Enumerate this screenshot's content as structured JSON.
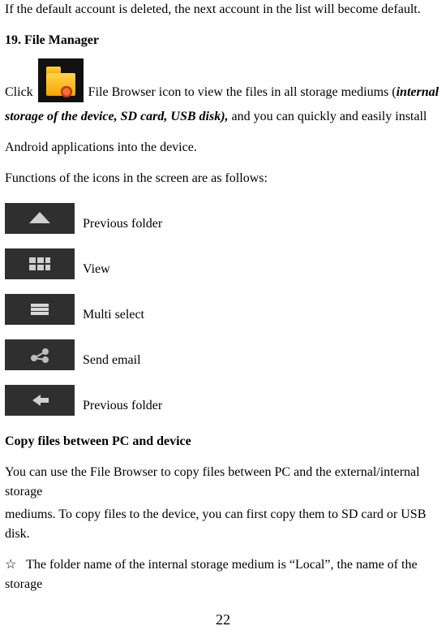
{
  "intro_line": "If the default account is deleted, the next account in the list will become default.",
  "section_heading": "19. File Manager",
  "click_label": "Click",
  "after_icon_text_1": " File Browser icon to view the files in all storage mediums (",
  "bold_italic_1": "internal storage of the device, SD card, USB disk),",
  "after_bold_1": " and you can quickly and easily install",
  "cont_line_2": "Android applications into the device.",
  "functions_line": "Functions of the icons in the screen are as follows:",
  "icons": [
    {
      "name": "previous-folder-icon",
      "label": "Previous folder"
    },
    {
      "name": "view-icon",
      "label": "View"
    },
    {
      "name": "multi-select-icon",
      "label": "Multi select"
    },
    {
      "name": "send-email-icon",
      "label": "Send email"
    },
    {
      "name": "previous-folder-icon-2",
      "label": "Previous folder"
    }
  ],
  "copy_heading": "Copy files between PC and device",
  "copy_para1": "You can use the File Browser to copy files between PC and the external/internal storage",
  "copy_para2": "mediums. To copy files to the device, you can first copy them to SD card or USB disk.",
  "star": "☆",
  "star_line": "The folder name of the internal storage medium is “Local”, the name of the storage",
  "page_number": "22"
}
